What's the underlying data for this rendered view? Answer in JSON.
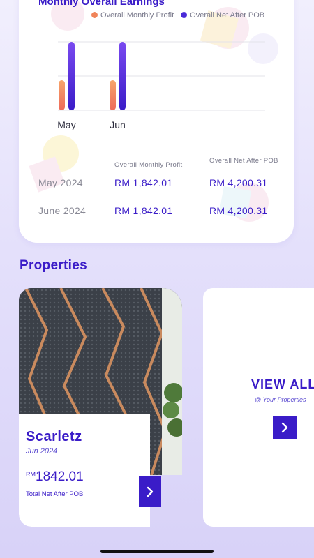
{
  "earnings": {
    "title": "Monthly Overall Earnings",
    "legend": [
      {
        "label": "Overall Monthly Profit",
        "color": "#f0845a"
      },
      {
        "label": "Overall Net After POB",
        "color": "#4a2ad8"
      }
    ],
    "table": {
      "headers": [
        "Overall Monthly Profit",
        "Overall Net After POB"
      ],
      "rows": [
        {
          "month": "May 2024",
          "profit": "RM 1,842.01",
          "net": "RM 4,200.31"
        },
        {
          "month": "June 2024",
          "profit": "RM 1,842.01",
          "net": "RM 4,200.31"
        }
      ]
    }
  },
  "chart_data": {
    "type": "bar",
    "categories": [
      "May",
      "Jun"
    ],
    "series": [
      {
        "name": "Overall Monthly Profit",
        "values": [
          1842.01,
          1842.01
        ],
        "color": "#f0845a"
      },
      {
        "name": "Overall Net After POB",
        "values": [
          4200.31,
          4200.31
        ],
        "color": "#4a2ad8"
      }
    ],
    "title": "Monthly Overall Earnings",
    "ylim": [
      0,
      4200.31
    ],
    "grid": true,
    "legend": "top-right"
  },
  "properties": {
    "section_title": "Properties",
    "cards": [
      {
        "name": "Scarletz",
        "date": "Jun 2024",
        "currency": "RM",
        "amount": "1842.01",
        "subtitle": "Total Net After POB",
        "arrow_icon": "chevron-right-icon"
      }
    ],
    "view_all": {
      "title": "VIEW ALL",
      "subtitle": "@ Your Properties",
      "arrow_icon": "chevron-right-icon"
    }
  },
  "colors": {
    "accent": "#3a1cc8",
    "profit": "#f0845a",
    "net": "#4a2ad8"
  }
}
